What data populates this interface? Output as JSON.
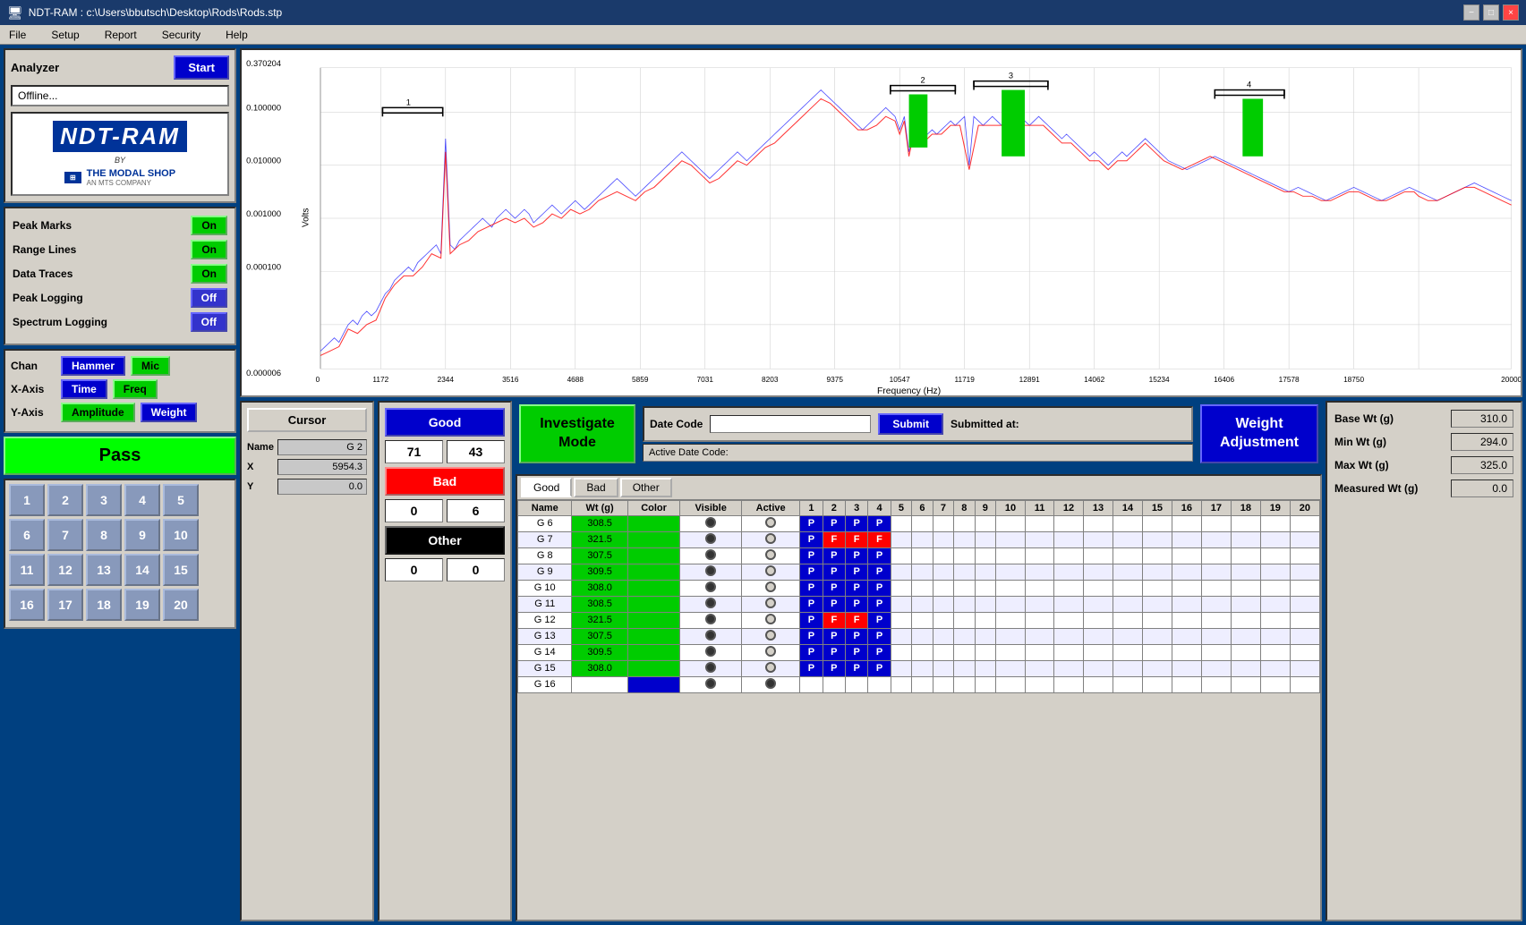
{
  "titlebar": {
    "title": "NDT-RAM : c:\\Users\\bbutsch\\Desktop\\Rods\\Rods.stp",
    "minimize": "−",
    "maximize": "□",
    "close": "×"
  },
  "menubar": {
    "items": [
      "File",
      "Setup",
      "Report",
      "Security",
      "Help"
    ]
  },
  "analyzer": {
    "label": "Analyzer",
    "start_label": "Start",
    "offline_label": "Offline..."
  },
  "controls": {
    "peak_marks_label": "Peak Marks",
    "peak_marks_state": "On",
    "range_lines_label": "Range Lines",
    "range_lines_state": "On",
    "data_traces_label": "Data Traces",
    "data_traces_state": "On",
    "peak_logging_label": "Peak Logging",
    "peak_logging_state": "Off",
    "spectrum_logging_label": "Spectrum Logging",
    "spectrum_logging_state": "Off"
  },
  "chan_section": {
    "chan_label": "Chan",
    "hammer_label": "Hammer",
    "mic_label": "Mic",
    "xaxis_label": "X-Axis",
    "time_label": "Time",
    "freq_label": "Freq",
    "yaxis_label": "Y-Axis",
    "amplitude_label": "Amplitude",
    "weight_label": "Weight"
  },
  "pass_fail": {
    "label": "Pass"
  },
  "num_grid": {
    "rows": [
      [
        1,
        2,
        3,
        4,
        5
      ],
      [
        6,
        7,
        8,
        9,
        10
      ],
      [
        11,
        12,
        13,
        14,
        15
      ],
      [
        16,
        17,
        18,
        19,
        20
      ]
    ]
  },
  "cursor": {
    "button_label": "Cursor",
    "name_label": "Name",
    "name_val": "G 2",
    "x_label": "X",
    "x_val": "5954.3",
    "y_label": "Y",
    "y_val": "0.0"
  },
  "investigate": {
    "label": "Investigate\nMode"
  },
  "weight_adj": {
    "label": "Weight\nAdjustment"
  },
  "date_code": {
    "label": "Date Code",
    "active_label": "Active Date Code:",
    "submit_label": "Submit",
    "submitted_at_label": "Submitted at:"
  },
  "tabs": {
    "items": [
      "Good",
      "Bad",
      "Other"
    ]
  },
  "table": {
    "headers": [
      "Name",
      "Wt (g)",
      "Color",
      "Visible",
      "Active",
      "1",
      "2",
      "3",
      "4",
      "5",
      "6",
      "7",
      "8",
      "9",
      "10",
      "11",
      "12",
      "13",
      "14",
      "15",
      "16",
      "17",
      "18",
      "19",
      "20"
    ],
    "rows": [
      {
        "name": "G 6",
        "wt": "308.5",
        "color": "green",
        "visible": "radio",
        "active": "radio_open",
        "peaks": [
          "P",
          "P",
          "P",
          "P",
          "",
          "",
          "",
          "",
          "",
          "",
          "",
          "",
          "",
          "",
          "",
          ""
        ]
      },
      {
        "name": "G 7",
        "wt": "321.5",
        "color": "green",
        "visible": "radio",
        "active": "radio_open",
        "peaks": [
          "P",
          "F",
          "F",
          "F",
          "",
          "",
          "",
          "",
          "",
          "",
          "",
          "",
          "",
          "",
          "",
          ""
        ]
      },
      {
        "name": "G 8",
        "wt": "307.5",
        "color": "green",
        "visible": "radio",
        "active": "radio_open",
        "peaks": [
          "P",
          "P",
          "P",
          "P",
          "",
          "",
          "",
          "",
          "",
          "",
          "",
          "",
          "",
          "",
          "",
          ""
        ]
      },
      {
        "name": "G 9",
        "wt": "309.5",
        "color": "green",
        "visible": "radio",
        "active": "radio_open",
        "peaks": [
          "P",
          "P",
          "P",
          "P",
          "",
          "",
          "",
          "",
          "",
          "",
          "",
          "",
          "",
          "",
          "",
          ""
        ]
      },
      {
        "name": "G 10",
        "wt": "308.0",
        "color": "green",
        "visible": "radio",
        "active": "radio_open",
        "peaks": [
          "P",
          "P",
          "P",
          "P",
          "",
          "",
          "",
          "",
          "",
          "",
          "",
          "",
          "",
          "",
          "",
          ""
        ]
      },
      {
        "name": "G 11",
        "wt": "308.5",
        "color": "green",
        "visible": "radio",
        "active": "radio_open",
        "peaks": [
          "P",
          "P",
          "P",
          "P",
          "",
          "",
          "",
          "",
          "",
          "",
          "",
          "",
          "",
          "",
          "",
          ""
        ]
      },
      {
        "name": "G 12",
        "wt": "321.5",
        "color": "green",
        "visible": "radio",
        "active": "radio_open",
        "peaks": [
          "P",
          "F",
          "F",
          "P",
          "",
          "",
          "",
          "",
          "",
          "",
          "",
          "",
          "",
          "",
          "",
          ""
        ]
      },
      {
        "name": "G 13",
        "wt": "307.5",
        "color": "green",
        "visible": "radio",
        "active": "radio_open",
        "peaks": [
          "P",
          "P",
          "P",
          "P",
          "",
          "",
          "",
          "",
          "",
          "",
          "",
          "",
          "",
          "",
          "",
          ""
        ]
      },
      {
        "name": "G 14",
        "wt": "309.5",
        "color": "green",
        "visible": "radio",
        "active": "radio_open",
        "peaks": [
          "P",
          "P",
          "P",
          "P",
          "",
          "",
          "",
          "",
          "",
          "",
          "",
          "",
          "",
          "",
          "",
          ""
        ]
      },
      {
        "name": "G 15",
        "wt": "308.0",
        "color": "green",
        "visible": "radio",
        "active": "radio_open",
        "peaks": [
          "P",
          "P",
          "P",
          "P",
          "",
          "",
          "",
          "",
          "",
          "",
          "",
          "",
          "",
          "",
          "",
          ""
        ]
      },
      {
        "name": "G 16",
        "wt": "",
        "color": "blue",
        "visible": "radio",
        "active": "radio",
        "peaks": [
          "",
          "",
          "",
          "",
          "",
          "",
          "",
          "",
          "",
          "",
          "",
          "",
          "",
          "",
          "",
          "",
          "",
          "",
          "",
          "",
          ""
        ]
      }
    ]
  },
  "right_info": {
    "base_wt_label": "Base Wt (g)",
    "base_wt_val": "310.0",
    "min_wt_label": "Min Wt (g)",
    "min_wt_val": "294.0",
    "max_wt_label": "Max Wt (g)",
    "max_wt_val": "325.0",
    "measured_wt_label": "Measured Wt (g)",
    "measured_wt_val": "0.0"
  },
  "gbo": {
    "good_label": "Good",
    "bad_label": "Bad",
    "other_label": "Other",
    "good_count1": "71",
    "good_count2": "43",
    "bad_count1": "0",
    "bad_count2": "6",
    "other_count1": "0",
    "other_count2": "0"
  },
  "chart": {
    "y_axis_label": "Volts",
    "x_axis_label": "Frequency (Hz)",
    "y_ticks": [
      "0.370204",
      "0.100000",
      "0.010000",
      "0.001000",
      "0.000100",
      "0.000006"
    ],
    "x_ticks": [
      "0",
      "1172",
      "2344",
      "3516",
      "4688",
      "5859",
      "7031",
      "8203",
      "9375",
      "10547",
      "11719",
      "12891",
      "14062",
      "15234",
      "16406",
      "17578",
      "18750",
      "20000"
    ],
    "markers": [
      "1",
      "2",
      "3",
      "4"
    ]
  }
}
